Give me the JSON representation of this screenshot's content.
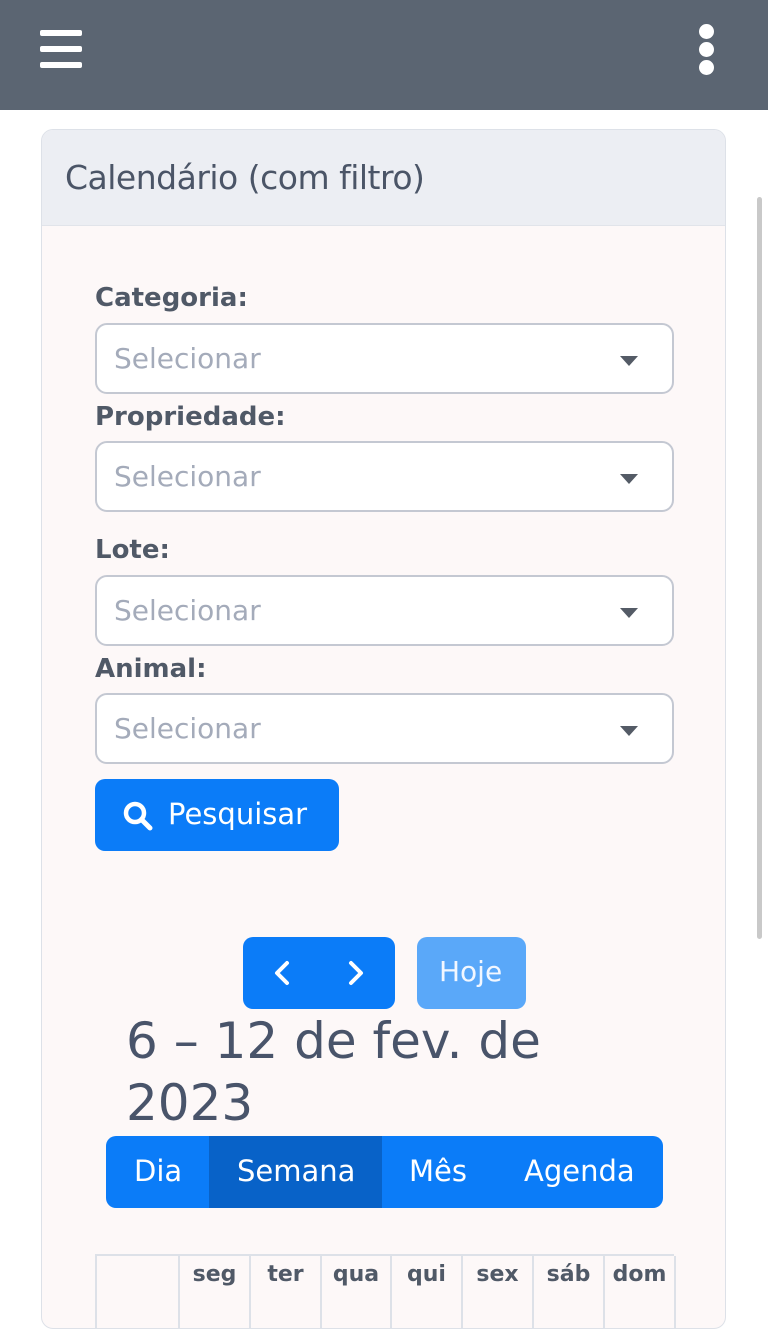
{
  "header": {
    "menu_icon": "hamburger-icon",
    "more_icon": "kebab-icon"
  },
  "card": {
    "title": "Calendário (com filtro)"
  },
  "filters": [
    {
      "label": "Categoria:",
      "placeholder": "Selecionar"
    },
    {
      "label": "Propriedade:",
      "placeholder": "Selecionar"
    },
    {
      "label": "Lote:",
      "placeholder": "Selecionar"
    },
    {
      "label": "Animal:",
      "placeholder": "Selecionar"
    }
  ],
  "search_button": {
    "label": "Pesquisar",
    "icon": "search-icon"
  },
  "calendar": {
    "today_label": "Hoje",
    "range_title": "6 – 12 de fev. de 2023",
    "views": [
      "Dia",
      "Semana",
      "Mês",
      "Agenda"
    ],
    "active_view": "Semana",
    "day_headers": [
      "seg",
      "ter",
      "qua",
      "qui",
      "sex",
      "sáb",
      "dom"
    ]
  },
  "colors": {
    "primary": "#0b7cf8",
    "primary_active": "#0862c8",
    "topbar": "#5b6572"
  }
}
